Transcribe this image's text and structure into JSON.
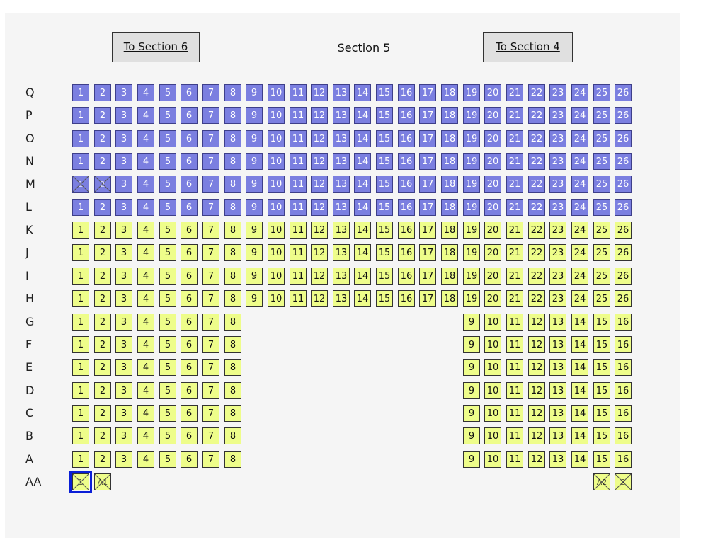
{
  "nav": {
    "left_label": "To Section 6",
    "right_label": "To Section 4"
  },
  "title": "Section 5",
  "colors": {
    "purple_seat": "#7b7fe0",
    "yellow_seat": "#eefd8a",
    "selected_outline": "#0a1ed6"
  },
  "rows": [
    {
      "label": "Q",
      "color": "purple",
      "seats": [
        "1",
        "2",
        "3",
        "4",
        "5",
        "6",
        "7",
        "8",
        "9",
        "10",
        "11",
        "12",
        "13",
        "14",
        "15",
        "16",
        "17",
        "18",
        "19",
        "20",
        "21",
        "22",
        "23",
        "24",
        "25",
        "26"
      ]
    },
    {
      "label": "P",
      "color": "purple",
      "seats": [
        "1",
        "2",
        "3",
        "4",
        "5",
        "6",
        "7",
        "8",
        "9",
        "10",
        "11",
        "12",
        "13",
        "14",
        "15",
        "16",
        "17",
        "18",
        "19",
        "20",
        "21",
        "22",
        "23",
        "24",
        "25",
        "26"
      ]
    },
    {
      "label": "O",
      "color": "purple",
      "seats": [
        "1",
        "2",
        "3",
        "4",
        "5",
        "6",
        "7",
        "8",
        "9",
        "10",
        "11",
        "12",
        "13",
        "14",
        "15",
        "16",
        "17",
        "18",
        "19",
        "20",
        "21",
        "22",
        "23",
        "24",
        "25",
        "26"
      ]
    },
    {
      "label": "N",
      "color": "purple",
      "seats": [
        "1",
        "2",
        "3",
        "4",
        "5",
        "6",
        "7",
        "8",
        "9",
        "10",
        "11",
        "12",
        "13",
        "14",
        "15",
        "16",
        "17",
        "18",
        "19",
        "20",
        "21",
        "22",
        "23",
        "24",
        "25",
        "26"
      ]
    },
    {
      "label": "M",
      "color": "purple",
      "unavailable": [
        "1",
        "2"
      ],
      "seats": [
        "1",
        "2",
        "3",
        "4",
        "5",
        "6",
        "7",
        "8",
        "9",
        "10",
        "11",
        "12",
        "13",
        "14",
        "15",
        "16",
        "17",
        "18",
        "19",
        "20",
        "21",
        "22",
        "23",
        "24",
        "25",
        "26"
      ]
    },
    {
      "label": "L",
      "color": "purple",
      "seats": [
        "1",
        "2",
        "3",
        "4",
        "5",
        "6",
        "7",
        "8",
        "9",
        "10",
        "11",
        "12",
        "13",
        "14",
        "15",
        "16",
        "17",
        "18",
        "19",
        "20",
        "21",
        "22",
        "23",
        "24",
        "25",
        "26"
      ]
    },
    {
      "label": "K",
      "color": "yellow",
      "seats": [
        "1",
        "2",
        "3",
        "4",
        "5",
        "6",
        "7",
        "8",
        "9",
        "10",
        "11",
        "12",
        "13",
        "14",
        "15",
        "16",
        "17",
        "18",
        "19",
        "20",
        "21",
        "22",
        "23",
        "24",
        "25",
        "26"
      ]
    },
    {
      "label": "J",
      "color": "yellow",
      "seats": [
        "1",
        "2",
        "3",
        "4",
        "5",
        "6",
        "7",
        "8",
        "9",
        "10",
        "11",
        "12",
        "13",
        "14",
        "15",
        "16",
        "17",
        "18",
        "19",
        "20",
        "21",
        "22",
        "23",
        "24",
        "25",
        "26"
      ]
    },
    {
      "label": "I",
      "color": "yellow",
      "seats": [
        "1",
        "2",
        "3",
        "4",
        "5",
        "6",
        "7",
        "8",
        "9",
        "10",
        "11",
        "12",
        "13",
        "14",
        "15",
        "16",
        "17",
        "18",
        "19",
        "20",
        "21",
        "22",
        "23",
        "24",
        "25",
        "26"
      ]
    },
    {
      "label": "H",
      "color": "yellow",
      "seats": [
        "1",
        "2",
        "3",
        "4",
        "5",
        "6",
        "7",
        "8",
        "9",
        "10",
        "11",
        "12",
        "13",
        "14",
        "15",
        "16",
        "17",
        "18",
        "19",
        "20",
        "21",
        "22",
        "23",
        "24",
        "25",
        "26"
      ]
    },
    {
      "label": "G",
      "color": "yellow",
      "split": true,
      "left": [
        "1",
        "2",
        "3",
        "4",
        "5",
        "6",
        "7",
        "8"
      ],
      "right": [
        "9",
        "10",
        "11",
        "12",
        "13",
        "14",
        "15",
        "16"
      ]
    },
    {
      "label": "F",
      "color": "yellow",
      "split": true,
      "left": [
        "1",
        "2",
        "3",
        "4",
        "5",
        "6",
        "7",
        "8"
      ],
      "right": [
        "9",
        "10",
        "11",
        "12",
        "13",
        "14",
        "15",
        "16"
      ]
    },
    {
      "label": "E",
      "color": "yellow",
      "split": true,
      "left": [
        "1",
        "2",
        "3",
        "4",
        "5",
        "6",
        "7",
        "8"
      ],
      "right": [
        "9",
        "10",
        "11",
        "12",
        "13",
        "14",
        "15",
        "16"
      ]
    },
    {
      "label": "D",
      "color": "yellow",
      "split": true,
      "left": [
        "1",
        "2",
        "3",
        "4",
        "5",
        "6",
        "7",
        "8"
      ],
      "right": [
        "9",
        "10",
        "11",
        "12",
        "13",
        "14",
        "15",
        "16"
      ]
    },
    {
      "label": "C",
      "color": "yellow",
      "split": true,
      "left": [
        "1",
        "2",
        "3",
        "4",
        "5",
        "6",
        "7",
        "8"
      ],
      "right": [
        "9",
        "10",
        "11",
        "12",
        "13",
        "14",
        "15",
        "16"
      ]
    },
    {
      "label": "B",
      "color": "yellow",
      "split": true,
      "left": [
        "1",
        "2",
        "3",
        "4",
        "5",
        "6",
        "7",
        "8"
      ],
      "right": [
        "9",
        "10",
        "11",
        "12",
        "13",
        "14",
        "15",
        "16"
      ]
    },
    {
      "label": "A",
      "color": "yellow",
      "split": true,
      "left": [
        "1",
        "2",
        "3",
        "4",
        "5",
        "6",
        "7",
        "8"
      ],
      "right": [
        "9",
        "10",
        "11",
        "12",
        "13",
        "14",
        "15",
        "16"
      ]
    },
    {
      "label": "AA",
      "color": "yellow",
      "split": true,
      "left": [
        "1",
        "A1"
      ],
      "right": [
        "A2",
        "2"
      ],
      "unavailable": [
        "1",
        "A1",
        "A2",
        "2"
      ],
      "selected": [
        "1"
      ]
    }
  ]
}
